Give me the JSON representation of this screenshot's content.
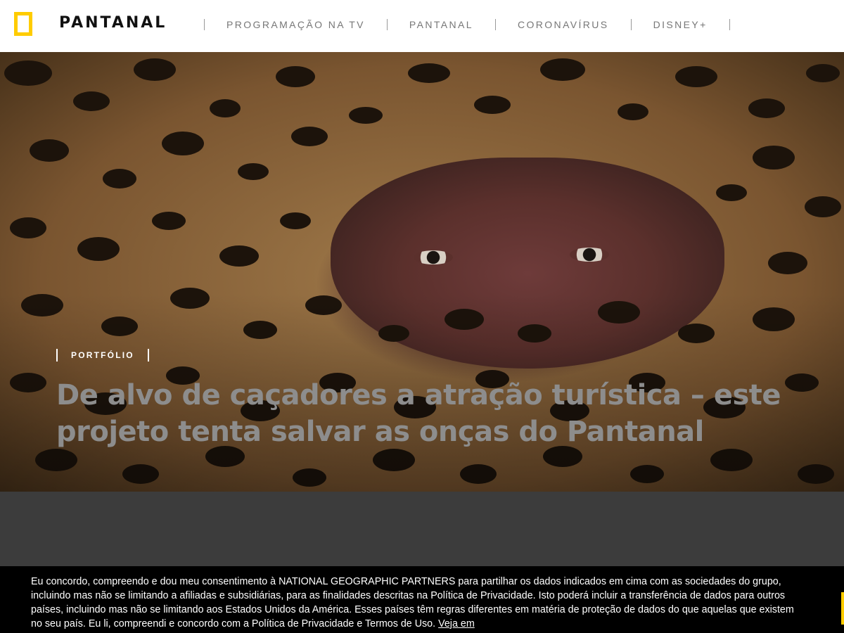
{
  "header": {
    "site_title": "PANTANAL",
    "nav": [
      "PROGRAMAÇÃO NA TV",
      "PANTANAL",
      "CORONAVÍRUS",
      "DISNEY+"
    ]
  },
  "hero": {
    "kicker": "PORTFÓLIO",
    "headline": "De alvo de caçadores a atração turística – este projeto tenta salvar as onças do Pantanal"
  },
  "consent": {
    "text": "Eu concordo, compreendo e dou meu consentimento à NATIONAL GEOGRAPHIC PARTNERS para partilhar os dados indicados em cima com as sociedades do grupo, incluindo mas não se limitando a afiliadas e subsidiárias, para as finalidades descritas na Política de Privacidade. Isto poderá incluir a transferência de dados para outros países, incluindo mas não se limitando aos Estados Unidos da América. Esses países têm regras diferentes em matéria de proteção de dados do que aquelas que existem no seu país. Eu li, compreendi e concordo com a Política de Privacidade e Termos de Uso.",
    "link": "Veja em"
  },
  "colors": {
    "accent": "#ffcc00",
    "header_bg": "#ffffff",
    "consent_bg": "#000000"
  },
  "icons": {
    "logo": "yellow-rectangle-logo-icon"
  }
}
